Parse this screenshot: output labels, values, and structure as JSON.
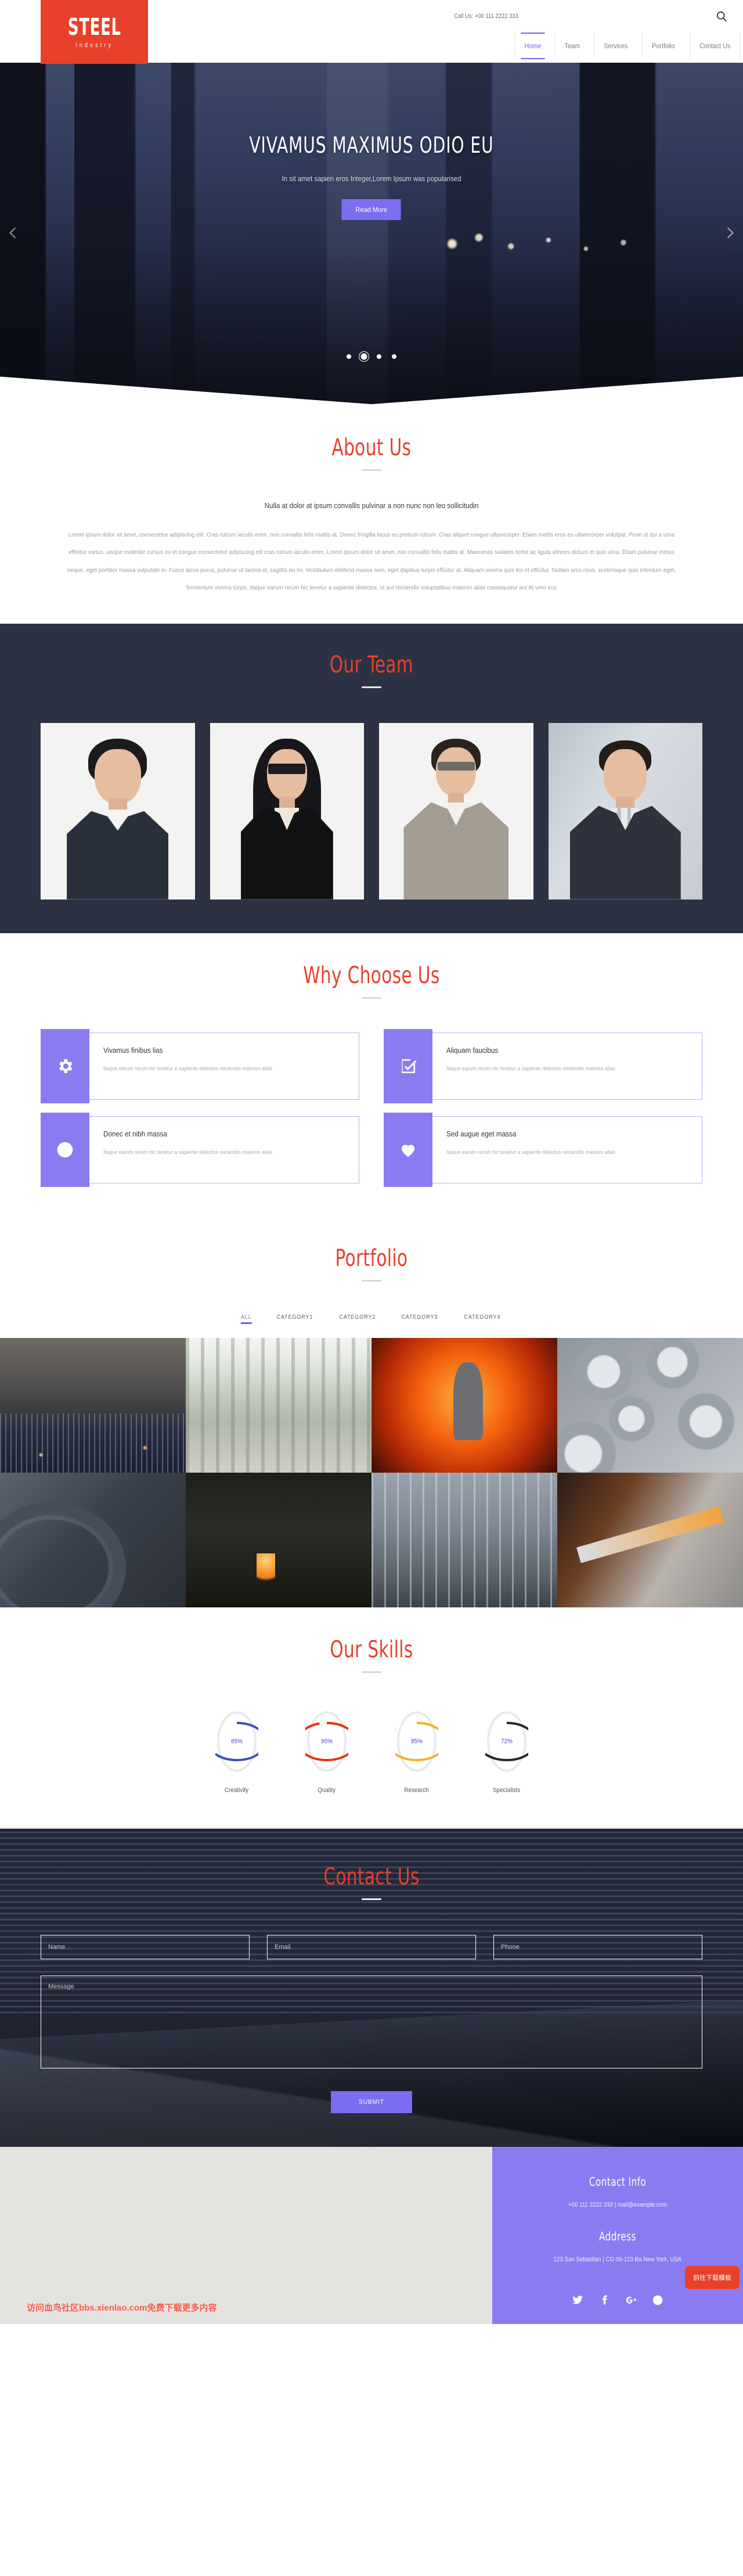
{
  "header": {
    "logo": {
      "main": "STEEL",
      "sub": "Industry"
    },
    "call_us": "Call Us: +00 111 2222 333",
    "search_icon": "search-icon",
    "nav": [
      {
        "label": "Home",
        "active": true
      },
      {
        "label": "Team",
        "active": false
      },
      {
        "label": "Services",
        "active": false
      },
      {
        "label": "Portfolio",
        "active": false
      },
      {
        "label": "Contact Us",
        "active": false
      }
    ]
  },
  "hero": {
    "title": "VIVAMUS MAXIMUS ODIO EU",
    "subtitle": "In sit amet sapien eros Integer,Lorem Ipsum was popularised",
    "button": "Read More",
    "dots": 4,
    "active_dot": 2,
    "prev_icon": "chevron-left-icon",
    "next_icon": "chevron-right-icon"
  },
  "about": {
    "title": "About Us",
    "lead": "Nulla at dolor at ipsum convallis pulvinar a non nunc non leo sollicitudin",
    "body": "Lorem ipsum dolor sit amet, consectetur adipiscing elit. Cras rutrum iaculis enim, non convallis felis mattis at. Donec fringilla lacus eu pretium rutrum. Cras aliquet congue ullamcorper. Etiam mattis eros eu ullamcorper volutpat. Proin ut dui a urna efficitur varius. uisque molestie cursus mi et congue consectetur adipiscing elit cras rutrum iaculis enim, Lorem ipsum dolor sit amet, non convallis felis mattis at. Maecenas sodales tortor ac ligula ultrices dictum et quis urna. Etiam pulvinar metus neque, eget porttitor massa vulputate in. Fusce lacus purus, pulvinar ut lacinia id, sagittis eu mi. Vestibulum eleifend massa sem, eget dapibus turpis efficitur at. Aliquam viverra quis leo et efficitur. Nullam arcu risus, scelerisque quis interdum eget, fermentum viverra turpis. Itaque earum rerum hic tenetur a sapiente delectus, ut aut reiciendis voluptatibus maiores alias consequatur aut At vero eos"
  },
  "team": {
    "title": "Our Team",
    "members": [
      {
        "name": "team-member-1"
      },
      {
        "name": "team-member-2"
      },
      {
        "name": "team-member-3"
      },
      {
        "name": "team-member-4"
      }
    ]
  },
  "why": {
    "title": "Why Choose Us",
    "cards": [
      {
        "icon": "gear-icon",
        "heading": "Vivamus finibus lias",
        "text": "Itaque earum rerum hic tenetur a sapiente delectus reiciendis maiores alias"
      },
      {
        "icon": "check-square-icon",
        "heading": "Aliquam faucibus",
        "text": "Itaque earum rerum hic tenetur a sapiente delectus reiciendis maiores alias"
      },
      {
        "icon": "clock-icon",
        "heading": "Donec et nibh massa",
        "text": "Itaque earum rerum hic tenetur a sapiente delectus reiciendis maiores alias"
      },
      {
        "icon": "heart-icon",
        "heading": "Sed augue eget massa",
        "text": "Itaque earum rerum hic tenetur a sapiente delectus reiciendis maiores alias"
      }
    ]
  },
  "portfolio": {
    "title": "Portfolio",
    "filters": [
      {
        "label": "ALL",
        "active": true
      },
      {
        "label": "CATEGORY1",
        "active": false
      },
      {
        "label": "CATEGORY2",
        "active": false
      },
      {
        "label": "CATEGORY3",
        "active": false
      },
      {
        "label": "CATEGORY4",
        "active": false
      }
    ],
    "items": [
      {
        "name": "refinery-at-dusk"
      },
      {
        "name": "factory-assembly-line"
      },
      {
        "name": "worker-at-furnace"
      },
      {
        "name": "steel-nuts-pile"
      },
      {
        "name": "gears-and-flywheel"
      },
      {
        "name": "foundry-ladle-flame"
      },
      {
        "name": "plant-walkway-workers"
      },
      {
        "name": "molten-metal-pour"
      }
    ]
  },
  "skills": {
    "title": "Our Skills",
    "items": [
      {
        "label": "Creativity",
        "value": 65,
        "display": "65%",
        "color": "#3f51b5"
      },
      {
        "label": "Quality",
        "value": 95,
        "display": "95%",
        "color": "#e8340c"
      },
      {
        "label": "Research",
        "value": 85,
        "display": "85%",
        "color": "#f0b429"
      },
      {
        "label": "Specialists",
        "value": 72,
        "display": "72%",
        "color": "#2e2620"
      }
    ],
    "track_color": "#e9e9ee"
  },
  "contact": {
    "title": "Contact Us",
    "fields": {
      "name_placeholder": "Name",
      "email_placeholder": "Email",
      "phone_placeholder": "Phone",
      "message_placeholder": "Message"
    },
    "submit": "SUBMIT"
  },
  "footer": {
    "contact_heading": "Contact Info",
    "contact_line": "+00 111 2222 333 | mail@example.com",
    "address_heading": "Address",
    "address_line": "123 San Sebastian | CG 09-123 Ba New York, USA",
    "socials": [
      {
        "name": "twitter-icon"
      },
      {
        "name": "facebook-icon"
      },
      {
        "name": "google-plus-icon"
      },
      {
        "name": "dribbble-icon"
      }
    ],
    "download_badge": "前往下载模板",
    "watermark": "访问血鸟社区bbs.xienlao.com免费下载更多内容"
  },
  "theme": {
    "accent_red": "#e8402a",
    "accent_purple": "#8a7cf0",
    "dark_navy": "#2c3244"
  }
}
